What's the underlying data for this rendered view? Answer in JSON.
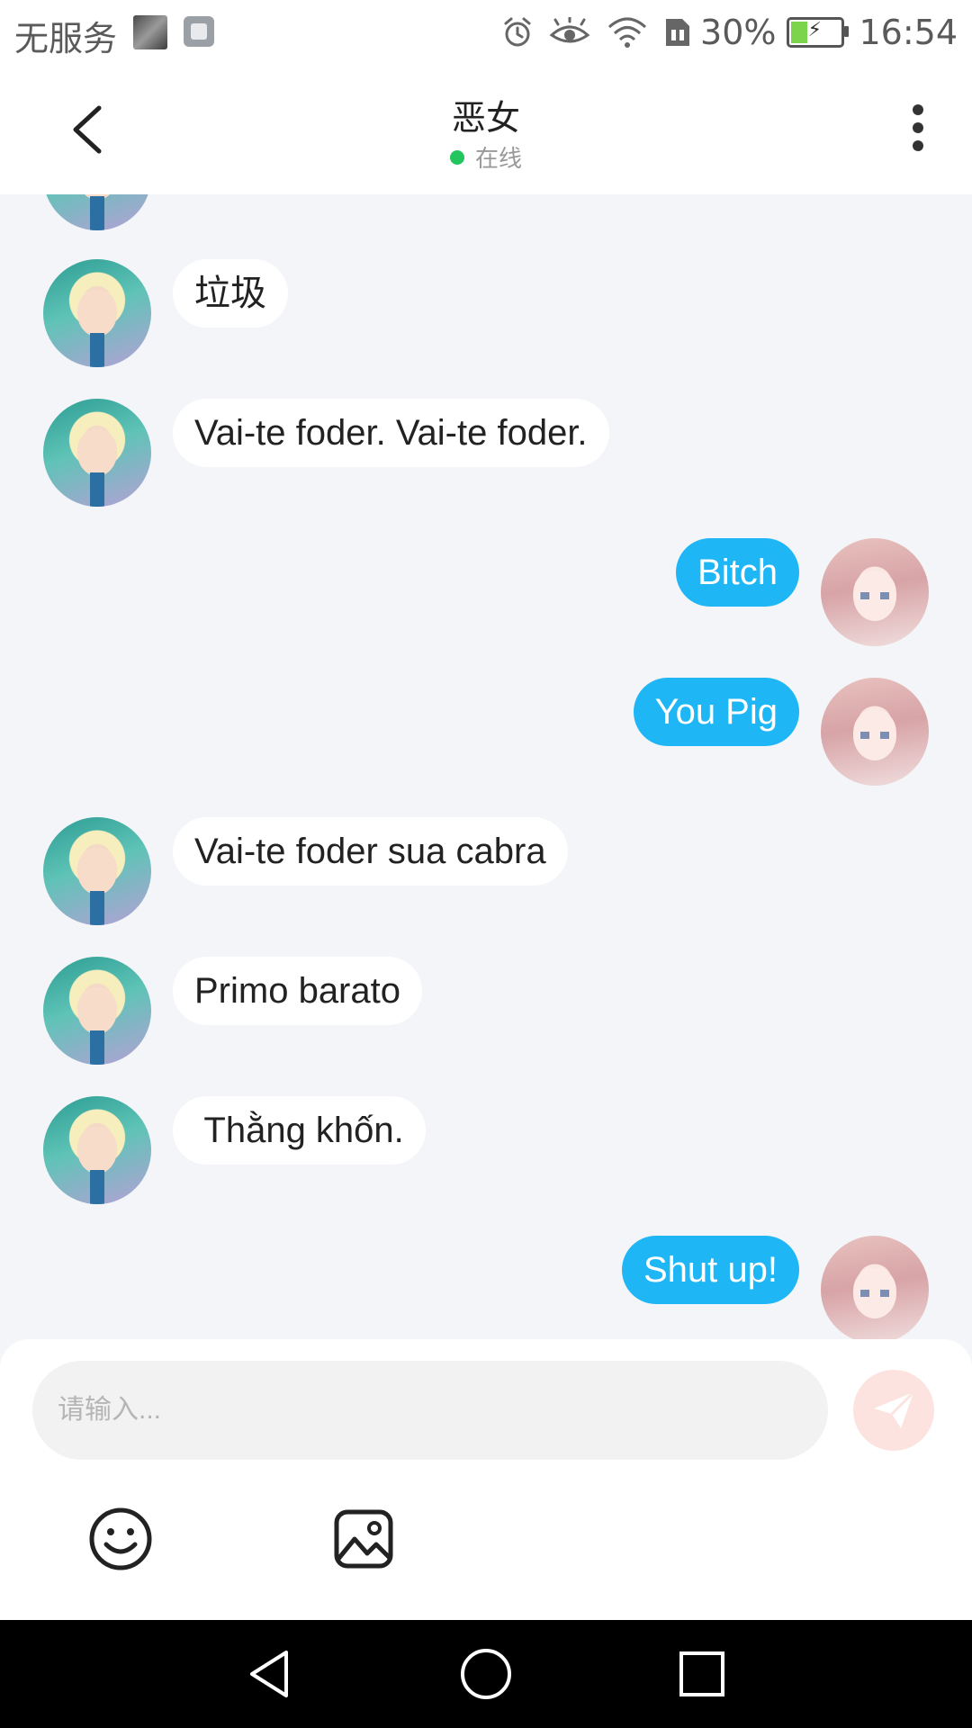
{
  "status_bar": {
    "carrier": "无服务",
    "battery_percent": "30%",
    "battery_level": 0.3,
    "time": "16:54",
    "icons": [
      "notification-thumbnail",
      "gallery-icon",
      "alarm-icon",
      "eye-icon",
      "wifi-icon",
      "sim-icon",
      "battery-icon"
    ]
  },
  "header": {
    "title": "恶女",
    "status": "在线",
    "back_icon": "chevron-left",
    "more_icon": "vertical-dots"
  },
  "messages": [
    {
      "side": "in",
      "text": "垃圾"
    },
    {
      "side": "in",
      "text": "Vai-te foder. Vai-te foder."
    },
    {
      "side": "out",
      "text": "Bitch"
    },
    {
      "side": "out",
      "text": "You Pig"
    },
    {
      "side": "in",
      "text": "Vai-te foder sua cabra"
    },
    {
      "side": "in",
      "text": "Primo barato"
    },
    {
      "side": "in",
      "text": " Thằng khốn."
    },
    {
      "side": "out",
      "text": "Shut up!"
    }
  ],
  "input": {
    "placeholder": "请输入...",
    "value": ""
  },
  "colors": {
    "outgoing_bubble": "#1fb6f5",
    "incoming_bubble": "#ffffff",
    "chat_background": "#f3f5f8",
    "online_dot": "#22c55e",
    "send_button": "#fde3df"
  }
}
